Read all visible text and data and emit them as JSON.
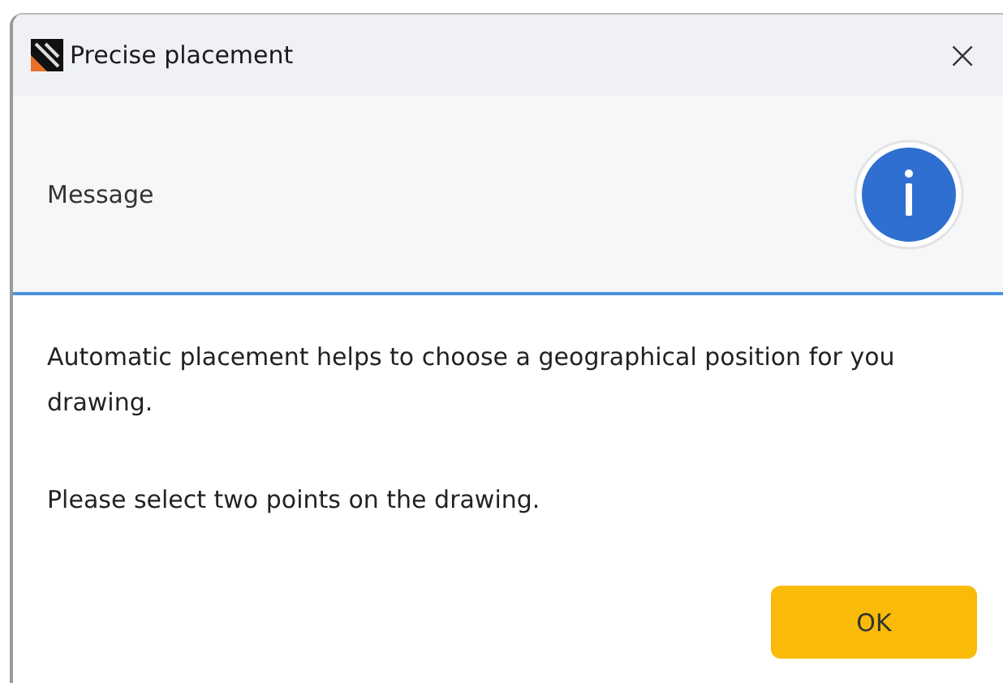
{
  "window": {
    "title": "Precise placement",
    "close": "×"
  },
  "header": {
    "label": "Message"
  },
  "paragraphs": [
    "Automatic placement helps to choose a geographical position for you drawing.",
    "Please select two points on the drawing."
  ],
  "buttons": [
    "OK"
  ]
}
